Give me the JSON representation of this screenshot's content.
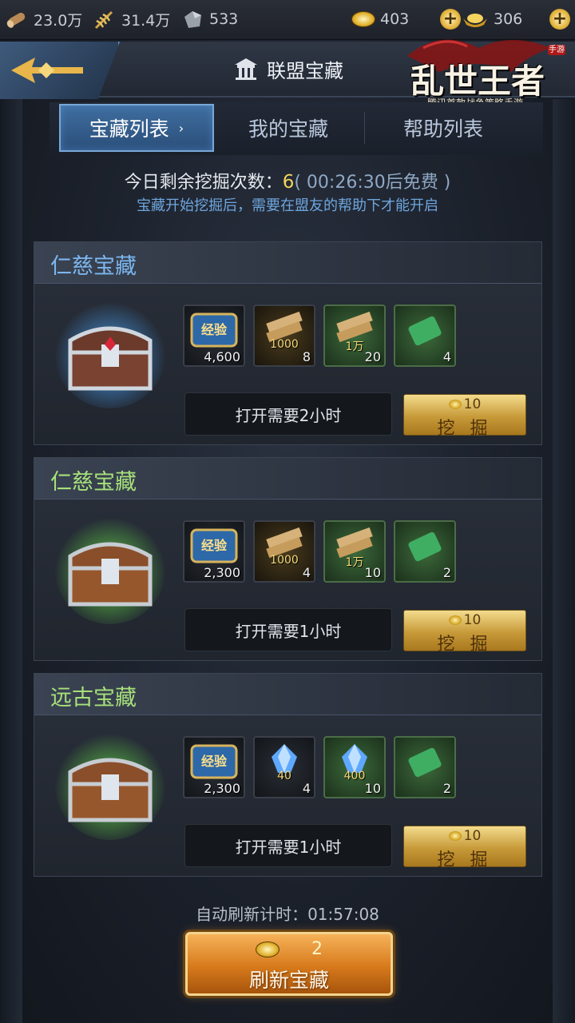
{
  "resources": {
    "wood": "23.0万",
    "grain": "31.4万",
    "stone": "533",
    "coins": "403",
    "gold": "306"
  },
  "header": {
    "title": "联盟宝藏",
    "logo_text": "乱世王者",
    "logo_sub": "腾讯首款战争策略手游",
    "logo_badge": "手游"
  },
  "tabs": [
    {
      "label": "宝藏列表",
      "active": true
    },
    {
      "label": "我的宝藏",
      "active": false
    },
    {
      "label": "帮助列表",
      "active": false
    }
  ],
  "info": {
    "dig_label": "今日剩余挖掘次数：",
    "dig_count": "6",
    "dig_free": "( 00:26:30后免费 )",
    "hint": "宝藏开始挖掘后，需要在盟友的帮助下才能开启"
  },
  "treasures": [
    {
      "title": "仁慈宝藏",
      "title_color": "#7cb6ef",
      "glow": "blue",
      "rewards": [
        {
          "icon": "exp-icon",
          "tag": "经验",
          "count": "4,600"
        },
        {
          "icon": "wood-bundle-icon",
          "tag": "1000",
          "count": "8"
        },
        {
          "icon": "wood-bundle-icon",
          "tag": "1万",
          "count": "20"
        },
        {
          "icon": "scroll-icon",
          "tag": "",
          "count": "4"
        }
      ],
      "time_text": "打开需要2小时",
      "cost": "10",
      "dig_label": "挖 掘"
    },
    {
      "title": "仁慈宝藏",
      "title_color": "#a7e07a",
      "glow": "green",
      "rewards": [
        {
          "icon": "exp-icon",
          "tag": "经验",
          "count": "2,300"
        },
        {
          "icon": "wood-bundle-icon",
          "tag": "1000",
          "count": "4"
        },
        {
          "icon": "wood-bundle-icon",
          "tag": "1万",
          "count": "10"
        },
        {
          "icon": "scroll-icon",
          "tag": "",
          "count": "2"
        }
      ],
      "time_text": "打开需要1小时",
      "cost": "10",
      "dig_label": "挖 掘"
    },
    {
      "title": "远古宝藏",
      "title_color": "#a7e07a",
      "glow": "green",
      "rewards": [
        {
          "icon": "exp-icon",
          "tag": "经验",
          "count": "2,300"
        },
        {
          "icon": "crystal-icon",
          "tag": "40",
          "count": "4"
        },
        {
          "icon": "crystal-icon",
          "tag": "400",
          "count": "10"
        },
        {
          "icon": "scroll-icon",
          "tag": "",
          "count": "2"
        }
      ],
      "time_text": "打开需要1小时",
      "cost": "10",
      "dig_label": "挖 掘"
    }
  ],
  "footer": {
    "auto_refresh": "自动刷新计时：01:57:08",
    "refresh_cost": "2",
    "refresh_label": "刷新宝藏"
  }
}
